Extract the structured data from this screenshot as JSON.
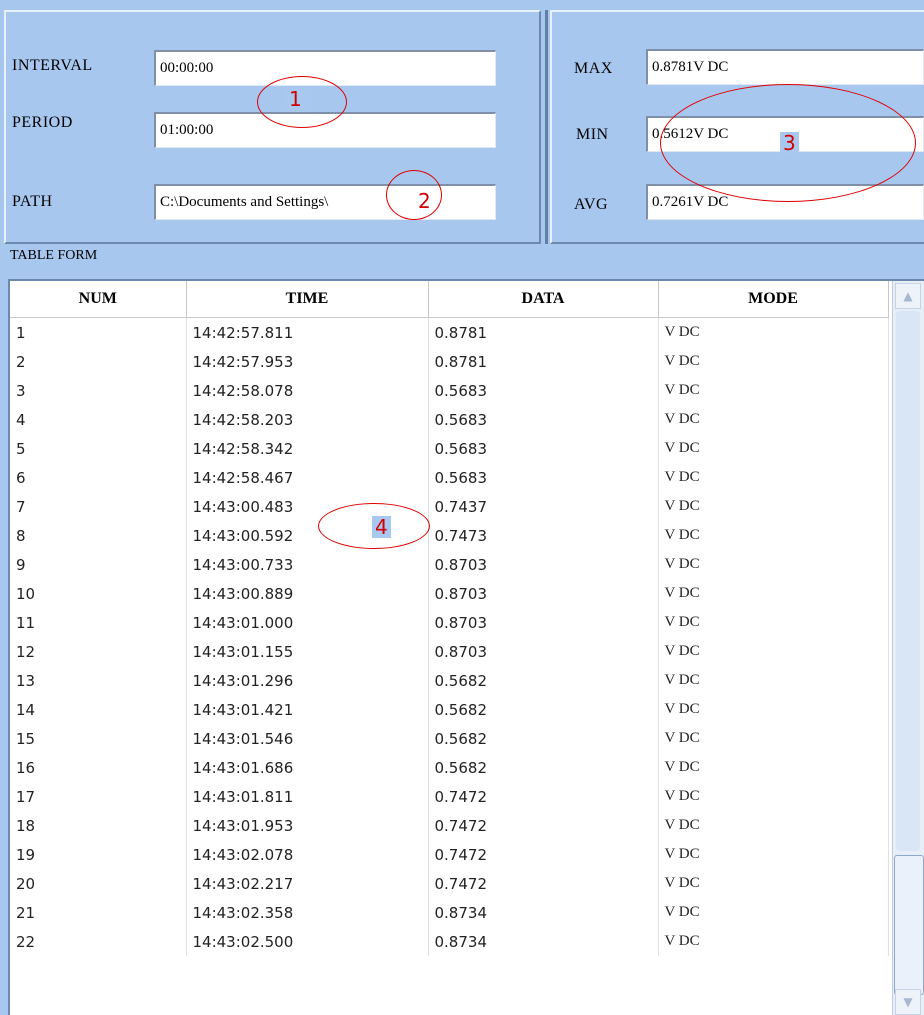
{
  "settings": {
    "interval_label": "INTERVAL",
    "interval_value": "00:00:00",
    "period_label": "PERIOD",
    "period_value": "01:00:00",
    "path_label": "PATH",
    "path_value": "C:\\Documents and Settings\\"
  },
  "stats": {
    "max_label": "MAX",
    "max_value": "0.8781V DC",
    "min_label": "MIN",
    "min_value": "0.5612V DC",
    "avg_label": "AVG",
    "avg_value": "0.7261V DC"
  },
  "annotations": [
    "1",
    "2",
    "3",
    "4"
  ],
  "annotation_color": "#e00000",
  "table": {
    "title": "TABLE FORM",
    "columns": [
      "NUM",
      "TIME",
      "DATA",
      "MODE"
    ],
    "rows": [
      [
        "1",
        "14:42:57.811",
        "0.8781",
        "V DC"
      ],
      [
        "2",
        "14:42:57.953",
        "0.8781",
        "V DC"
      ],
      [
        "3",
        "14:42:58.078",
        "0.5683",
        "V DC"
      ],
      [
        "4",
        "14:42:58.203",
        "0.5683",
        "V DC"
      ],
      [
        "5",
        "14:42:58.342",
        "0.5683",
        "V DC"
      ],
      [
        "6",
        "14:42:58.467",
        "0.5683",
        "V DC"
      ],
      [
        "7",
        "14:43:00.483",
        "0.7437",
        "V DC"
      ],
      [
        "8",
        "14:43:00.592",
        "0.7473",
        "V DC"
      ],
      [
        "9",
        "14:43:00.733",
        "0.8703",
        "V DC"
      ],
      [
        "10",
        "14:43:00.889",
        "0.8703",
        "V DC"
      ],
      [
        "11",
        "14:43:01.000",
        "0.8703",
        "V DC"
      ],
      [
        "12",
        "14:43:01.155",
        "0.8703",
        "V DC"
      ],
      [
        "13",
        "14:43:01.296",
        "0.5682",
        "V DC"
      ],
      [
        "14",
        "14:43:01.421",
        "0.5682",
        "V DC"
      ],
      [
        "15",
        "14:43:01.546",
        "0.5682",
        "V DC"
      ],
      [
        "16",
        "14:43:01.686",
        "0.5682",
        "V DC"
      ],
      [
        "17",
        "14:43:01.811",
        "0.7472",
        "V DC"
      ],
      [
        "18",
        "14:43:01.953",
        "0.7472",
        "V DC"
      ],
      [
        "19",
        "14:43:02.078",
        "0.7472",
        "V DC"
      ],
      [
        "20",
        "14:43:02.217",
        "0.7472",
        "V DC"
      ],
      [
        "21",
        "14:43:02.358",
        "0.8734",
        "V DC"
      ],
      [
        "22",
        "14:43:02.500",
        "0.8734",
        "V DC"
      ]
    ]
  },
  "scrollbar": {
    "up_icon": "scroll-up-arrow-icon",
    "down_icon": "scroll-down-arrow-icon"
  }
}
